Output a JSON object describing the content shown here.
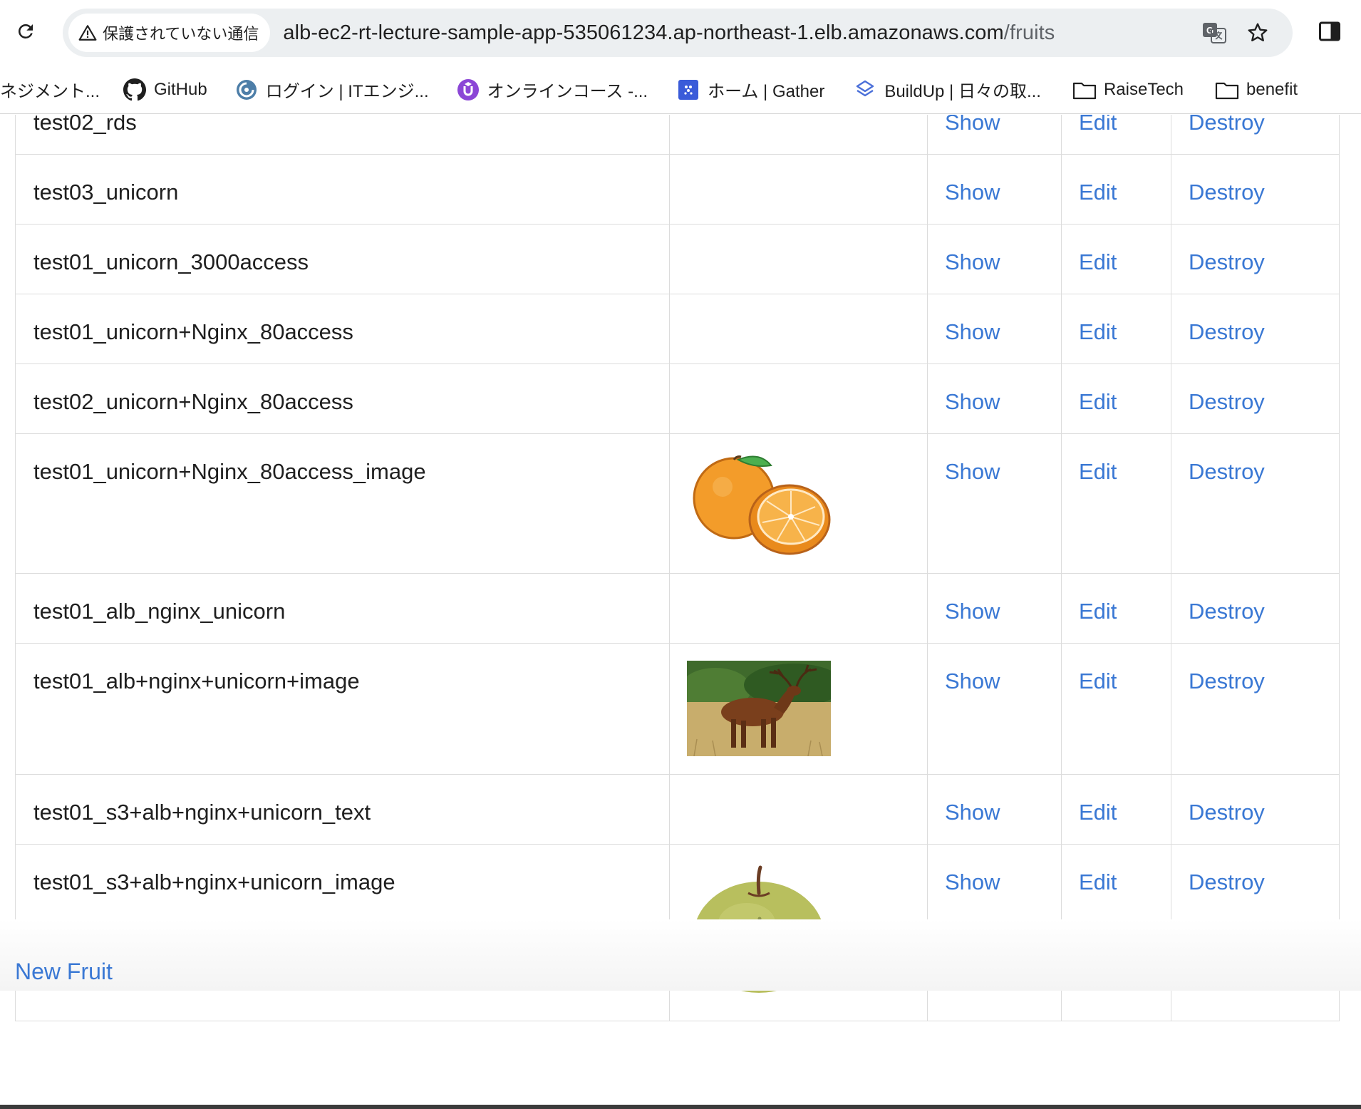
{
  "browser": {
    "security_label": "保護されていない通信",
    "url_host": "alb-ec2-rt-lecture-sample-app-535061234.ap-northeast-1.elb.amazonaws.com",
    "url_path": "/fruits",
    "icons": [
      "reload-icon",
      "warning-icon",
      "translate-icon",
      "star-icon",
      "side-panel-icon"
    ],
    "bookmarks": [
      {
        "label": "ネジメント...",
        "icon": "none"
      },
      {
        "label": "GitHub",
        "icon": "github-icon"
      },
      {
        "label": "ログイン | ITエンジ...",
        "icon": "site-icon"
      },
      {
        "label": "オンラインコース -...",
        "icon": "udemy-icon"
      },
      {
        "label": "ホーム | Gather",
        "icon": "gather-icon"
      },
      {
        "label": "BuildUp | 日々の取...",
        "icon": "buildup-icon"
      },
      {
        "label": "RaiseTech",
        "icon": "folder-icon"
      },
      {
        "label": "benefit",
        "icon": "folder-icon"
      }
    ]
  },
  "table": {
    "actions": {
      "show": "Show",
      "edit": "Edit",
      "destroy": "Destroy"
    },
    "rows": [
      {
        "name": "test02_rds",
        "image": ""
      },
      {
        "name": "test03_unicorn",
        "image": ""
      },
      {
        "name": "test01_unicorn_3000access",
        "image": ""
      },
      {
        "name": "test01_unicorn+Nginx_80access",
        "image": ""
      },
      {
        "name": "test02_unicorn+Nginx_80access",
        "image": ""
      },
      {
        "name": "test01_unicorn+Nginx_80access_image",
        "image": "orange"
      },
      {
        "name": "test01_alb_nginx_unicorn",
        "image": ""
      },
      {
        "name": "test01_alb+nginx+unicorn+image",
        "image": "deer"
      },
      {
        "name": "test01_s3+alb+nginx+unicorn_text",
        "image": ""
      },
      {
        "name": "test01_s3+alb+nginx+unicorn_image",
        "image": "pear"
      }
    ]
  },
  "new_fruit_link": "New Fruit",
  "colors": {
    "link": "#3a78d4",
    "border": "#dcdcdc",
    "omnibox": "#eceff1"
  }
}
